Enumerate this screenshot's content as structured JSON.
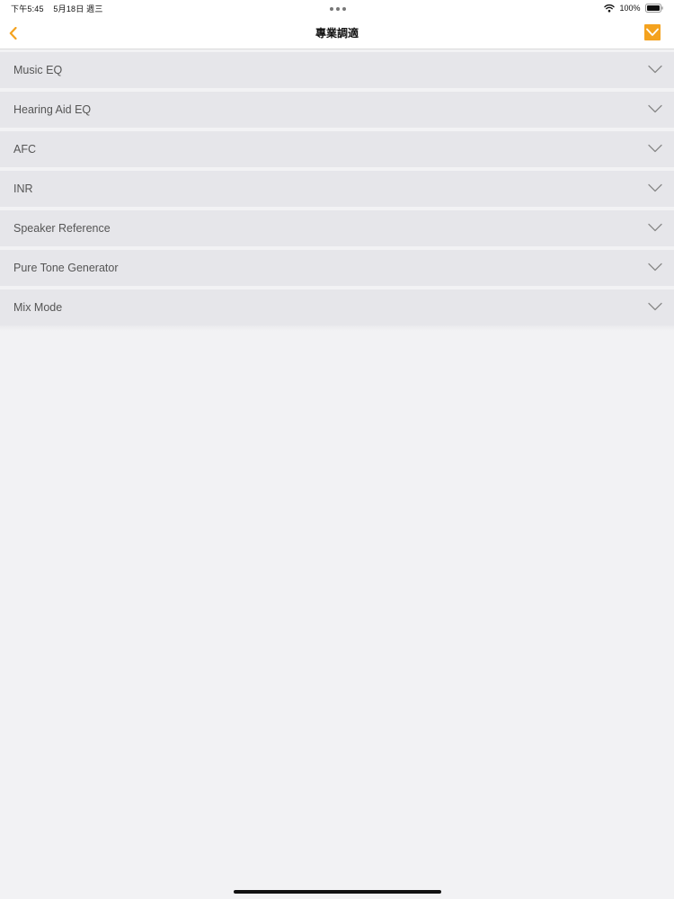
{
  "status_bar": {
    "time": "下午5:45",
    "date": "5月18日 週三",
    "battery": "100%",
    "wifi_icon": "wifi-icon",
    "battery_icon": "battery-full-icon"
  },
  "nav": {
    "back_icon": "chevron-left-icon",
    "title": "專業調適",
    "confirm_icon": "checkmark-icon",
    "accent_color": "#f4a21e"
  },
  "sections": [
    {
      "label": "Music EQ",
      "expanded": false
    },
    {
      "label": "Hearing Aid EQ",
      "expanded": false
    },
    {
      "label": "AFC",
      "expanded": false
    },
    {
      "label": "INR",
      "expanded": false
    },
    {
      "label": "Speaker Reference",
      "expanded": false
    },
    {
      "label": "Pure Tone Generator",
      "expanded": false
    },
    {
      "label": "Mix Mode",
      "expanded": false
    }
  ],
  "colors": {
    "section_background": "#e6e6ea",
    "page_background": "#f2f2f4",
    "chevron": "#888888"
  }
}
